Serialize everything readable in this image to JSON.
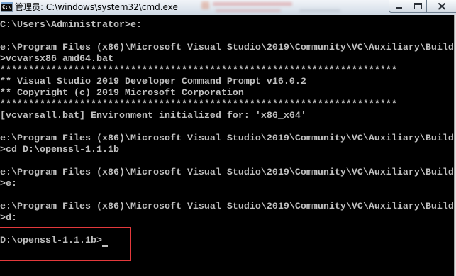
{
  "window": {
    "title": "管理员: C:\\windows\\system32\\cmd.exe",
    "app_icon": {
      "icon": "cmd-app-icon",
      "label": "C:\\"
    },
    "controls": {
      "minimize": {
        "icon": "minimize-icon"
      },
      "maximize": {
        "icon": "maximize-icon"
      },
      "close": {
        "icon": "close-icon"
      }
    }
  },
  "console": {
    "lines": [
      "C:\\Users\\Administrator>e:",
      "",
      "e:\\Program Files (x86)\\Microsoft Visual Studio\\2019\\Community\\VC\\Auxiliary\\Build",
      ">vcvarsx86_amd64.bat",
      "**********************************************************************",
      "** Visual Studio 2019 Developer Command Prompt v16.0.2",
      "** Copyright (c) 2019 Microsoft Corporation",
      "**********************************************************************",
      "[vcvarsall.bat] Environment initialized for: 'x86_x64'",
      "",
      "e:\\Program Files (x86)\\Microsoft Visual Studio\\2019\\Community\\VC\\Auxiliary\\Build",
      ">cd D:\\openssl-1.1.1b",
      "",
      "e:\\Program Files (x86)\\Microsoft Visual Studio\\2019\\Community\\VC\\Auxiliary\\Build",
      ">e:",
      "",
      "e:\\Program Files (x86)\\Microsoft Visual Studio\\2019\\Community\\VC\\Auxiliary\\Build",
      ">d:",
      "",
      "D:\\openssl-1.1.1b>"
    ]
  },
  "annotation": {
    "highlight_color": "#e4393c"
  },
  "colors": {
    "console_background": "#000000",
    "console_text": "#c0c0c0",
    "titlebar": "#dfe6ee"
  }
}
